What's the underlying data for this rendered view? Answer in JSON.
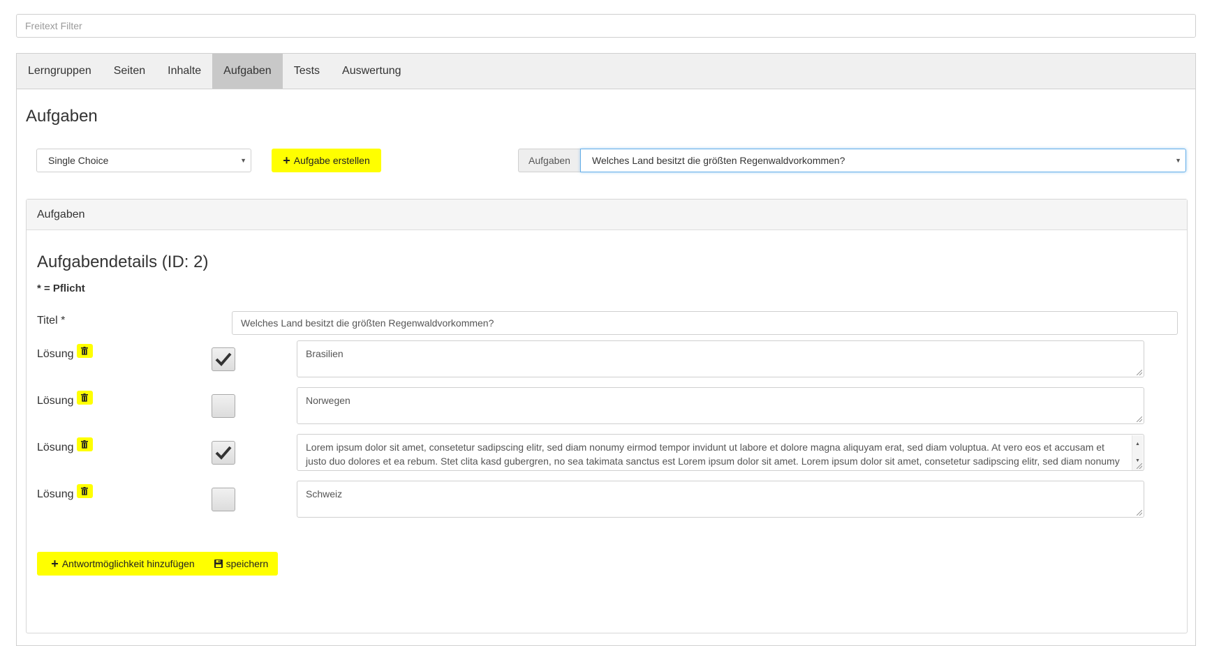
{
  "filter": {
    "placeholder": "Freitext Filter"
  },
  "tabs": [
    {
      "label": "Lerngruppen"
    },
    {
      "label": "Seiten"
    },
    {
      "label": "Inhalte"
    },
    {
      "label": "Aufgaben",
      "active": true
    },
    {
      "label": "Tests"
    },
    {
      "label": "Auswertung"
    }
  ],
  "page_title": "Aufgaben",
  "toolbar": {
    "type_select_value": "Single Choice",
    "create_button_label": "Aufgabe erstellen",
    "task_addon_label": "Aufgaben",
    "task_select_value": "Welches Land besitzt die größten Regenwaldvorkommen?"
  },
  "panel": {
    "heading": "Aufgaben",
    "details_title": "Aufgabendetails (ID: 2)",
    "required_note": "* = Pflicht",
    "title_label": "Titel *",
    "title_value": "Welches Land besitzt die größten Regenwaldvorkommen?",
    "solutions": [
      {
        "label": "Lösung",
        "checked": true,
        "text": "Brasilien"
      },
      {
        "label": "Lösung",
        "checked": false,
        "text": "Norwegen"
      },
      {
        "label": "Lösung",
        "checked": true,
        "text": "Lorem ipsum dolor sit amet, consetetur sadipscing elitr, sed diam nonumy eirmod tempor invidunt ut labore et dolore magna aliquyam erat, sed diam voluptua. At vero eos et accusam et justo duo dolores et ea rebum. Stet clita kasd gubergren, no sea takimata sanctus est Lorem ipsum dolor sit amet. Lorem ipsum dolor sit amet, consetetur sadipscing elitr, sed diam nonumy eirmod tempor invidunt ut labore et dolore magna aliquyam erat, sed diam voluptua."
      },
      {
        "label": "Lösung",
        "checked": false,
        "text": "Schweiz"
      }
    ],
    "add_answer_label": "Antwortmöglichkeit hinzufügen",
    "save_label": "speichern"
  },
  "colors": {
    "accent_yellow": "#ffff00",
    "focus_blue": "#66afe9",
    "active_tab": "#c8c8c8"
  },
  "icons": {
    "create": "plus-icon",
    "delete": "trash-icon",
    "save": "floppy-icon",
    "check": "check-icon"
  }
}
